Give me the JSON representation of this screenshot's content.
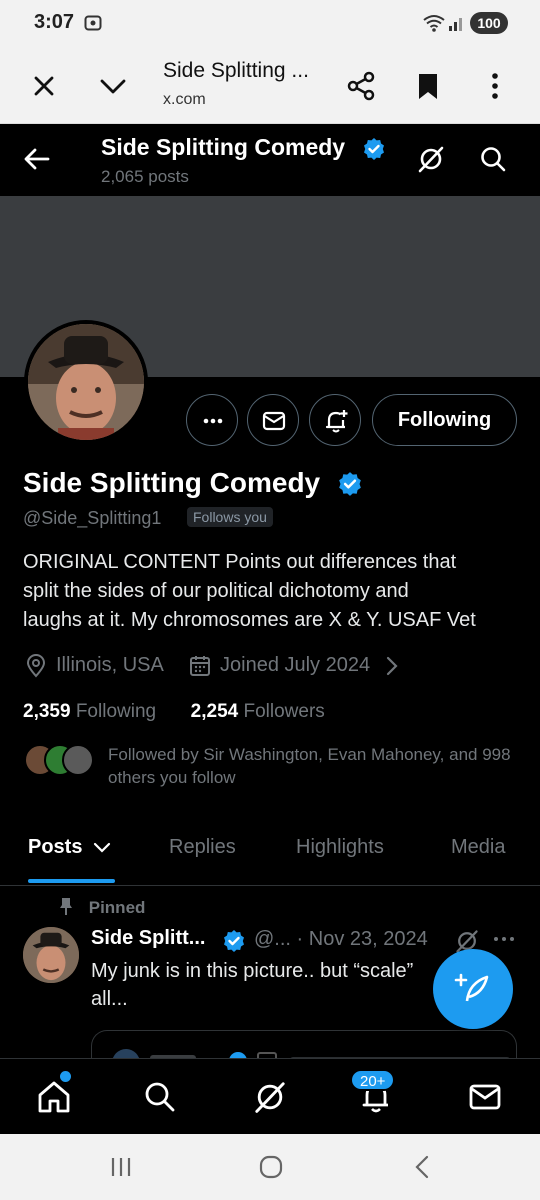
{
  "status_bar": {
    "time": "3:07",
    "battery": "100"
  },
  "browser": {
    "page_title": "Side Splitting ...",
    "url": "x.com"
  },
  "profile_header": {
    "name": "Side Splitting Comedy",
    "post_count": "2,065 posts"
  },
  "profile": {
    "display_name": "Side Splitting Comedy",
    "handle": "@Side_Splitting1",
    "follows_you_label": "Follows you",
    "following_button": "Following",
    "bio": "ORIGINAL CONTENT Points out differences that\nsplit the sides of our political dichotomy and\nlaughs at it. My chromosomes are X & Y. USAF Vet",
    "location": "Illinois, USA",
    "joined": "Joined July 2024",
    "following_count": "2,359",
    "following_label": "Following",
    "followers_count": "2,254",
    "followers_label": "Followers",
    "followed_by": "Followed by Sir Washington, Evan Mahoney, and 998 others you follow"
  },
  "tabs": [
    "Posts",
    "Replies",
    "Highlights",
    "Media"
  ],
  "pinned_tweet": {
    "pinned_label": "Pinned",
    "author": "Side Splitt...",
    "handle_date": "@... · Nov 23, 2024",
    "text": "My junk is in this picture.. but “scale” all..."
  },
  "bottom_nav": {
    "notification_badge": "20+"
  },
  "colors": {
    "accent": "#1d9bf0",
    "background": "#000000",
    "muted": "#71767b"
  }
}
